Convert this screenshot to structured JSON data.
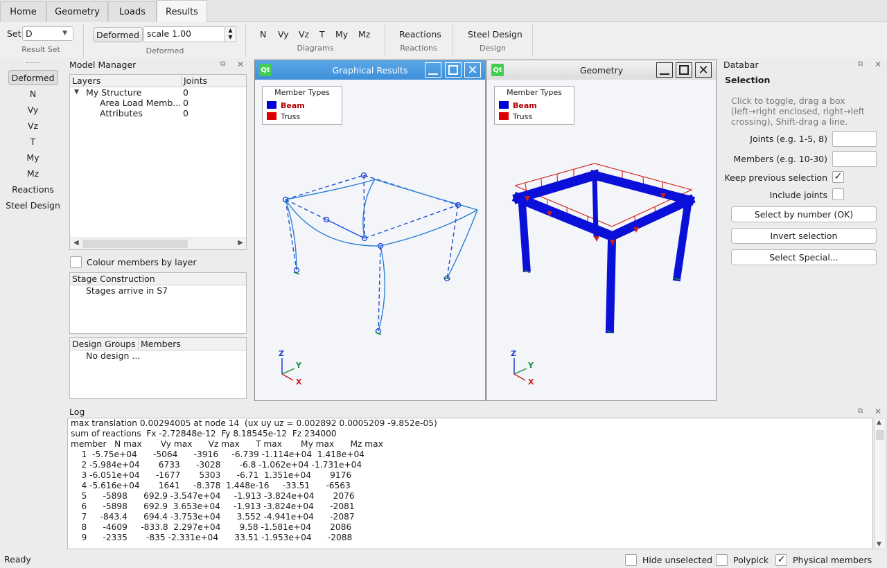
{
  "tabs": [
    {
      "label": "Home",
      "active": false
    },
    {
      "label": "Geometry",
      "active": false
    },
    {
      "label": "Loads",
      "active": false
    },
    {
      "label": "Results",
      "active": true
    }
  ],
  "ribbon": {
    "set_label": "Set",
    "set_value": "D",
    "result_set_caption": "Result Set",
    "deformed_button": "Deformed",
    "scale_value": "scale 1.00",
    "deformed_caption": "Deformed",
    "diagrams": [
      "N",
      "Vy",
      "Vz",
      "T",
      "My",
      "Mz"
    ],
    "diagrams_caption": "Diagrams",
    "reactions_button": "Reactions",
    "reactions_caption": "Reactions",
    "steel_design_button": "Steel Design",
    "design_caption": "Design"
  },
  "leftbar": [
    "Deformed",
    "N",
    "Vy",
    "Vz",
    "T",
    "My",
    "Mz",
    "Reactions",
    "Steel Design"
  ],
  "model_manager": {
    "title": "Model Manager",
    "col_layers": "Layers",
    "col_joints": "Joints",
    "rows": [
      {
        "name": "My Structure",
        "joints": "0"
      },
      {
        "name": "Area Load Memb...",
        "joints": "0"
      },
      {
        "name": "Attributes",
        "joints": "0"
      }
    ],
    "colour_by_layer": "Colour members by layer",
    "stage_title": "Stage Construction",
    "stage_text": "Stages arrive in S7",
    "design_groups_col": "Design Groups",
    "members_col": "Members",
    "design_text": "No design ..."
  },
  "graphical_window": {
    "title": "Graphical Results",
    "legend_title": "Member Types",
    "legend_items": [
      {
        "label": "Beam",
        "color": "#0000dd"
      },
      {
        "label": "Truss",
        "color": "#dd0000"
      }
    ],
    "axis_labels": [
      "Z",
      "Y",
      "X"
    ]
  },
  "geometry_window": {
    "title": "Geometry",
    "legend_title": "Member Types",
    "legend_items": [
      {
        "label": "Beam",
        "color": "#0000dd"
      },
      {
        "label": "Truss",
        "color": "#dd0000"
      }
    ],
    "axis_labels": [
      "Z",
      "Y",
      "X"
    ]
  },
  "databar": {
    "title": "Databar",
    "section": "Selection",
    "help": [
      "Click to toggle, drag a box",
      "(left→right enclosed, right→left",
      "crossing), Shift-drag a line."
    ],
    "joints_label": "Joints (e.g. 1-5, 8)",
    "members_label": "Members (e.g. 10-30)",
    "keep_prev": "Keep previous selection",
    "include_joints": "Include joints",
    "btn_select_number": "Select by number (OK)",
    "btn_invert": "Invert selection",
    "btn_special": "Select Special..."
  },
  "log": {
    "title": "Log",
    "lines": [
      "max translation 0.00294005 at node 14  (ux uy uz = 0.002892 0.0005209 -9.852e-05)",
      "sum of reactions  Fx -2.72848e-12  Fy 8.18545e-12  Fz 234000",
      "member   N max       Vy max      Vz max      T max       My max      Mz max",
      "    1  -5.75e+04      -5064      -3916     -6.739 -1.114e+04  1.418e+04",
      "    2 -5.984e+04       6733      -3028       -6.8 -1.062e+04 -1.731e+04",
      "    3 -6.051e+04      -1677       5303      -6.71  1.351e+04       9176",
      "    4 -5.616e+04       1641     -8.378  1.448e-16     -33.51      -6563",
      "    5      -5898      692.9 -3.547e+04     -1.913 -3.824e+04       2076",
      "    6      -5898      692.9  3.653e+04     -1.913 -3.824e+04      -2081",
      "    7     -843.4      694.4 -3.753e+04      3.552 -4.941e+04      -2087",
      "    8      -4609     -833.8  2.297e+04       9.58 -1.581e+04       2086",
      "    9      -2335       -835 -2.331e+04      33.51 -1.953e+04      -2088"
    ]
  },
  "statusbar": {
    "status": "Ready",
    "hide_unselected": "Hide unselected",
    "polypick": "Polypick",
    "physical_members": "Physical members"
  }
}
